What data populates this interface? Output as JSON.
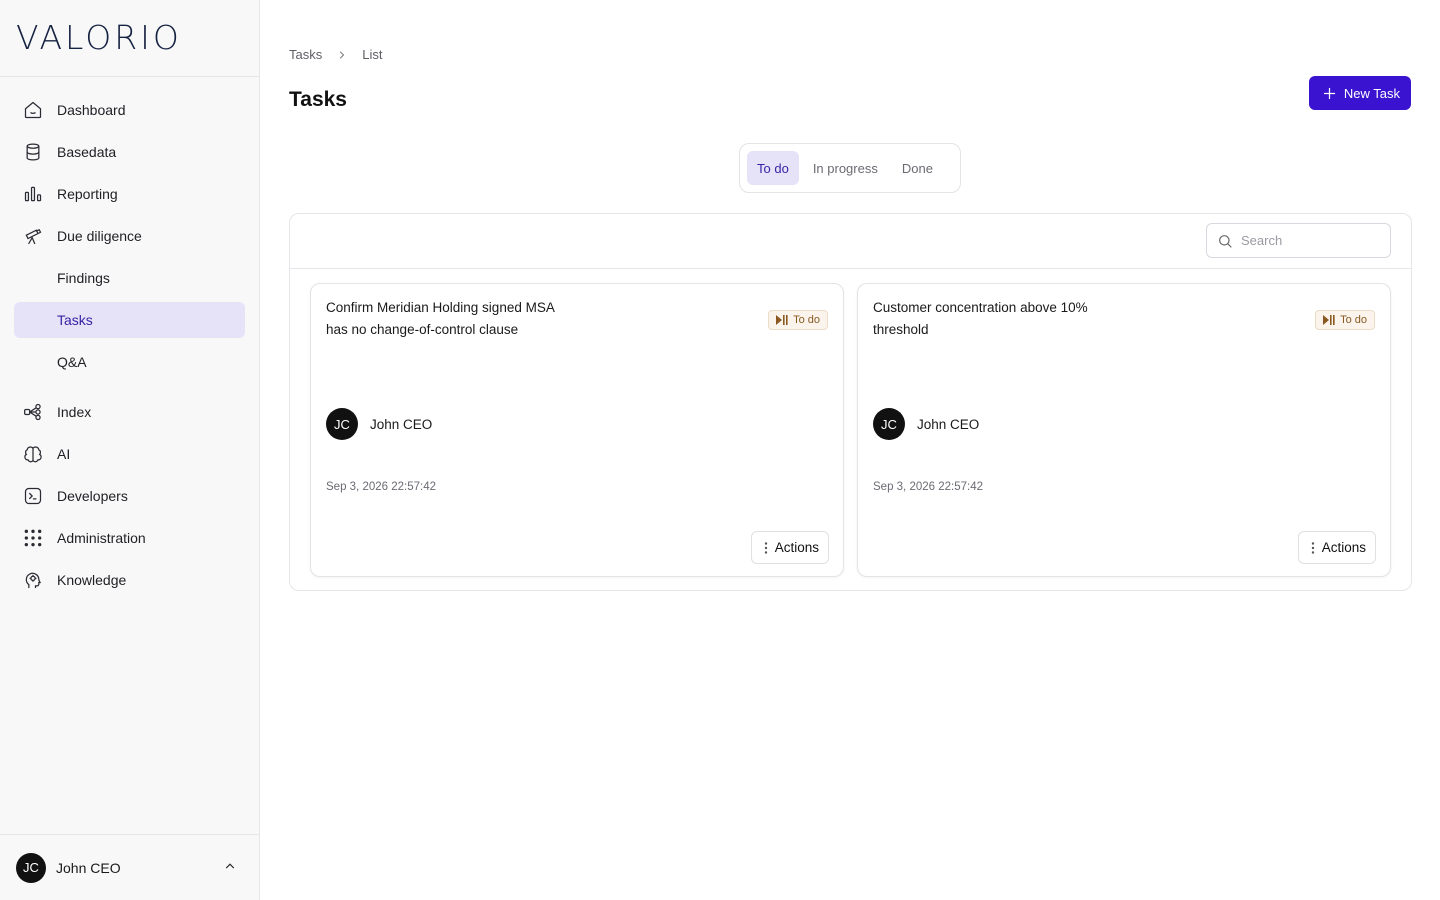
{
  "brand": {
    "logo_text": "VALORIO",
    "accent": "#3b5bdb"
  },
  "sidebar": {
    "items": [
      {
        "label": "Dashboard",
        "icon": "home-icon"
      },
      {
        "label": "Basedata",
        "icon": "database-icon"
      },
      {
        "label": "Reporting",
        "icon": "bar-chart-icon"
      },
      {
        "label": "Due diligence",
        "icon": "telescope-icon"
      },
      {
        "label": "Findings",
        "sub": true
      },
      {
        "label": "Tasks",
        "sub": true,
        "active": true
      },
      {
        "label": "Q&A",
        "sub": true
      },
      {
        "label": "Index",
        "icon": "network-icon"
      },
      {
        "label": "AI",
        "icon": "brain-icon"
      },
      {
        "label": "Developers",
        "icon": "terminal-icon"
      },
      {
        "label": "Administration",
        "icon": "grid-dots-icon"
      },
      {
        "label": "Knowledge",
        "icon": "head-icon"
      }
    ],
    "user": {
      "initials": "JC",
      "name": "John CEO"
    }
  },
  "breadcrumb": {
    "root": "Tasks",
    "current": "List"
  },
  "page": {
    "title": "Tasks",
    "new_button": "New Task"
  },
  "tabs": [
    {
      "label": "To do",
      "active": true
    },
    {
      "label": "In progress"
    },
    {
      "label": "Done"
    }
  ],
  "search": {
    "placeholder": "Search",
    "value": ""
  },
  "cards": [
    {
      "title": "Confirm Meridian Holding signed MSA has no change-of-control clause",
      "status": "To do",
      "assignee": {
        "initials": "JC",
        "name": "John CEO"
      },
      "timestamp": "Sep 3, 2026 22:57:42",
      "actions_label": "Actions"
    },
    {
      "title": "Customer concentration above 10% threshold",
      "status": "To do",
      "assignee": {
        "initials": "JC",
        "name": "John CEO"
      },
      "timestamp": "Sep 3, 2026 22:57:42",
      "actions_label": "Actions"
    }
  ],
  "colors": {
    "primary": "#3a13d0",
    "active_bg": "#e6e3f8",
    "active_text": "#3a21a6",
    "badge_bg": "#faf4ec",
    "badge_text": "#8a5a22"
  }
}
